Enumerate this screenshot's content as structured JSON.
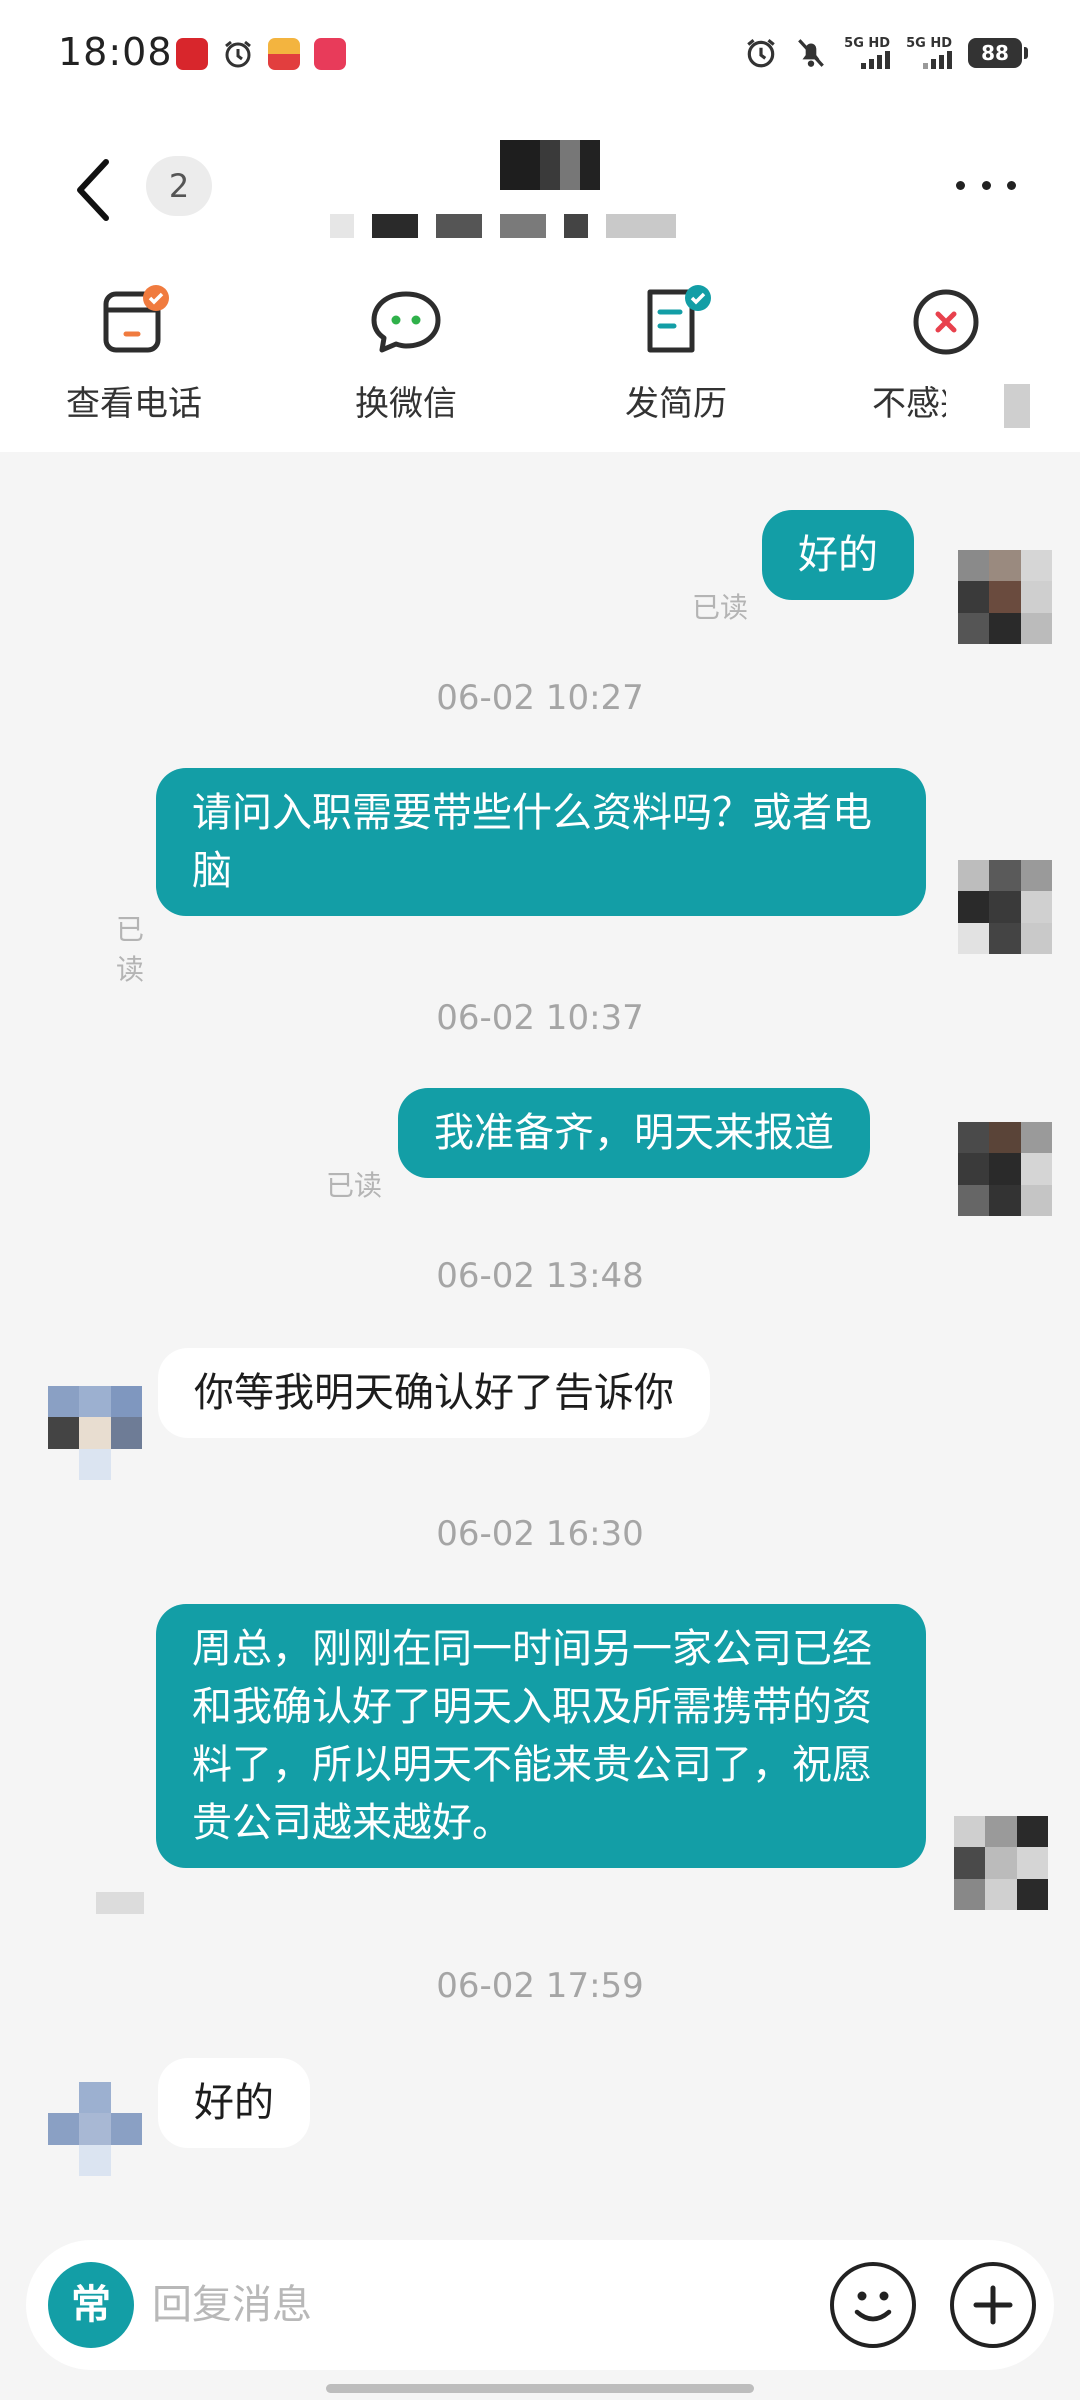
{
  "status_bar": {
    "time": "18:08",
    "battery": "88",
    "signal_1": "5G HD",
    "signal_2": "5G HD",
    "notification_icons": [
      "app-red-icon",
      "alarm-icon",
      "app-delivery-icon",
      "app-shop-icon"
    ],
    "system_icons": [
      "alarm-icon",
      "mute-icon",
      "signal-5g-icon",
      "signal-5g-icon",
      "battery-icon"
    ]
  },
  "header": {
    "unread_count": "2",
    "icons": [
      "back-chevron-icon",
      "more-dots-icon"
    ]
  },
  "actions": [
    {
      "label": "查看电话",
      "icon": "phone-card-icon"
    },
    {
      "label": "换微信",
      "icon": "chat-bubble-icon"
    },
    {
      "label": "发简历",
      "icon": "resume-icon"
    },
    {
      "label": "不感兴",
      "icon": "close-circle-icon"
    }
  ],
  "messages": [
    {
      "type": "out",
      "text": "好的",
      "read": "已读"
    },
    {
      "type": "time",
      "text": "06-02 10:27"
    },
    {
      "type": "out",
      "text": "请问入职需要带些什么资料吗？或者电脑",
      "read": "已读"
    },
    {
      "type": "time",
      "text": "06-02 10:37"
    },
    {
      "type": "out",
      "text": "我准备齐，明天来报道",
      "read": "已读"
    },
    {
      "type": "time",
      "text": "06-02 13:48"
    },
    {
      "type": "in",
      "text": "你等我明天确认好了告诉你"
    },
    {
      "type": "time",
      "text": "06-02 16:30"
    },
    {
      "type": "out",
      "text": "周总，刚刚在同一时间另一家公司已经和我确认好了明天入职及所需携带的资料了，所以明天不能来贵公司了，祝愿贵公司越来越好。"
    },
    {
      "type": "time",
      "text": "06-02 17:59"
    },
    {
      "type": "in",
      "text": "好的"
    }
  ],
  "input": {
    "quick_phrase_label": "常",
    "placeholder": "回复消息",
    "icons": [
      "emoji-icon",
      "plus-icon"
    ]
  },
  "colors": {
    "accent": "#139ea6",
    "chat_bg": "#f5f5f5",
    "badge_orange": "#f07b3f",
    "reject_red": "#e8414d"
  }
}
